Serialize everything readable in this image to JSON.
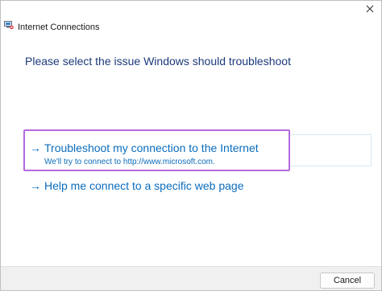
{
  "window": {
    "title": "Internet Connections"
  },
  "heading": "Please select the issue Windows should troubleshoot",
  "options": [
    {
      "arrow": "→",
      "title": "Troubleshoot my connection to the Internet",
      "description": "We'll try to connect to http://www.microsoft.com."
    },
    {
      "arrow": "→",
      "title": "Help me connect to a specific web page"
    }
  ],
  "footer": {
    "cancel_label": "Cancel"
  },
  "icons": {
    "app": "network-connection-icon",
    "close": "close-icon",
    "arrow": "arrow-right-icon"
  },
  "colors": {
    "link": "#0a6cbd",
    "heading": "#1c3a7a",
    "highlight_border": "#b36ae0"
  }
}
